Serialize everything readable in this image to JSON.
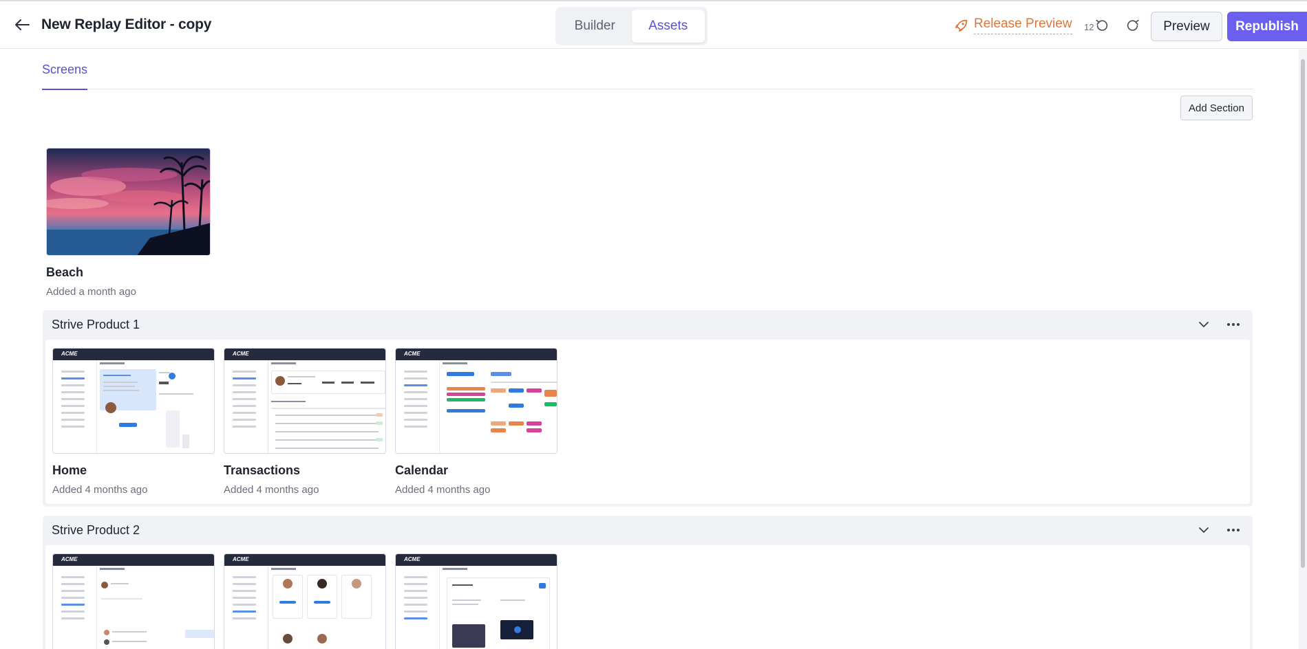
{
  "header": {
    "title": "New Replay Editor - copy",
    "mode_tabs": [
      {
        "label": "Builder",
        "active": false
      },
      {
        "label": "Assets",
        "active": true
      }
    ],
    "release_preview_label": "Release Preview",
    "undo_count": "12",
    "preview_label": "Preview",
    "republish_label": "Republish",
    "icons": {
      "back": "arrow-left-icon",
      "release": "rocket-icon",
      "undo": "undo-icon",
      "redo": "redo-icon"
    },
    "colors": {
      "accent": "#6b5ff0",
      "release": "#d9773a"
    }
  },
  "tabs": [
    {
      "label": "Screens",
      "active": true
    }
  ],
  "add_section_label": "Add Section",
  "ungrouped": [
    {
      "name": "Beach",
      "meta": "Added a month ago",
      "image": "beach-sunset-image"
    }
  ],
  "sections": [
    {
      "title": "Strive Product 1",
      "screens": [
        {
          "name": "Home",
          "meta": "Added 4 months ago",
          "logo": "ACME"
        },
        {
          "name": "Transactions",
          "meta": "Added 4 months ago",
          "logo": "ACME"
        },
        {
          "name": "Calendar",
          "meta": "Added 4 months ago",
          "logo": "ACME"
        }
      ]
    },
    {
      "title": "Strive Product 2",
      "screens": [
        {
          "logo": "ACME"
        },
        {
          "logo": "ACME"
        },
        {
          "logo": "ACME"
        }
      ]
    }
  ]
}
